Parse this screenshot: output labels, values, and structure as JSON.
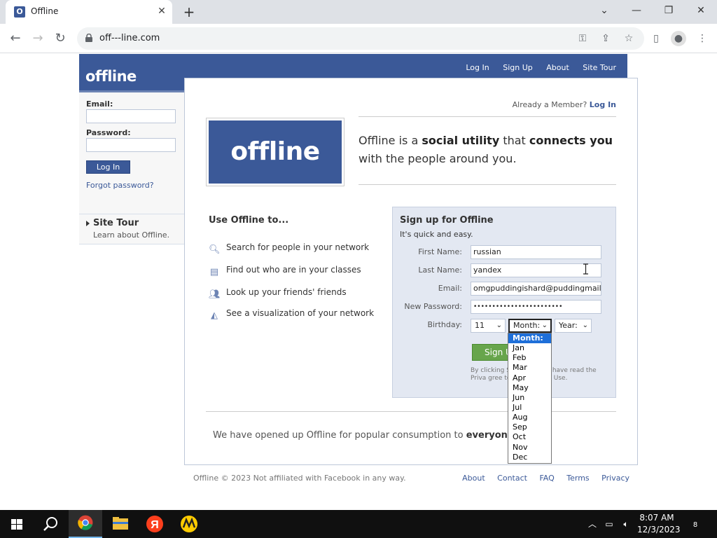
{
  "browser": {
    "tab_title": "Offline",
    "tab_favicon_letter": "O",
    "url": "off---line.com"
  },
  "site": {
    "logo": "offline",
    "nav": [
      "Log In",
      "Sign Up",
      "About",
      "Site Tour"
    ]
  },
  "sidebar": {
    "email_label": "Email:",
    "password_label": "Password:",
    "login_button": "Log In",
    "forgot_password": "Forgot password?",
    "tour_title": "Site Tour",
    "tour_sub": "Learn about Offline."
  },
  "main": {
    "member_prefix": "Already a Member?",
    "member_link": "Log In",
    "big_logo": "offline",
    "tagline": {
      "t1": "Offline is a ",
      "b1": "social utility",
      "t2": " that ",
      "b2": "connects you",
      "t3": " with the people around you."
    },
    "use_title": "Use Offline to...",
    "use_items": [
      {
        "icon": "search-icon",
        "label": "Search for people in your network"
      },
      {
        "icon": "classes-icon",
        "label": "Find out who are in your classes"
      },
      {
        "icon": "friends-icon",
        "label": "Look up your friends' friends"
      },
      {
        "icon": "network-icon",
        "label": "See a visualization of your network"
      }
    ],
    "everyone_prefix": "We have opened up Offline for popular consumption to ",
    "everyone_bold": "everyone",
    "everyone_suffix": "."
  },
  "signup": {
    "title": "Sign up for Offline",
    "subtitle": "It's quick and easy.",
    "first_name_label": "First Name:",
    "first_name_value": "russian",
    "last_name_label": "Last Name:",
    "last_name_value": "yandex",
    "email_label": "Email:",
    "email_value": "omgpuddingishard@puddingmail.xom",
    "password_label": "New Password:",
    "password_value": "••••••••••••••••••••••••",
    "birthday_label": "Birthday:",
    "day_value": "11",
    "month_value": "Month:",
    "year_value": "Year:",
    "button_label": "Sign Up",
    "terms_visible": "By clicking Si        ledge that I have read the Priva        gree to the Terms of Use."
  },
  "month_dropdown": {
    "options": [
      "Month:",
      "Jan",
      "Feb",
      "Mar",
      "Apr",
      "May",
      "Jun",
      "Jul",
      "Aug",
      "Sep",
      "Oct",
      "Nov",
      "Dec"
    ],
    "selected": "Month:"
  },
  "footer": {
    "copyright": "Offline © 2023   Not affiliated with Facebook in any way.",
    "links": [
      "About",
      "Contact",
      "FAQ",
      "Terms",
      "Privacy"
    ]
  },
  "taskbar": {
    "time": "8:07 AM",
    "date": "12/3/2023",
    "notification_count": "8"
  },
  "colors": {
    "brand": "#3b5998",
    "signup_bg": "#e3e8f2",
    "signup_button": "#67a54b",
    "dropdown_selected": "#1e6fd9"
  }
}
